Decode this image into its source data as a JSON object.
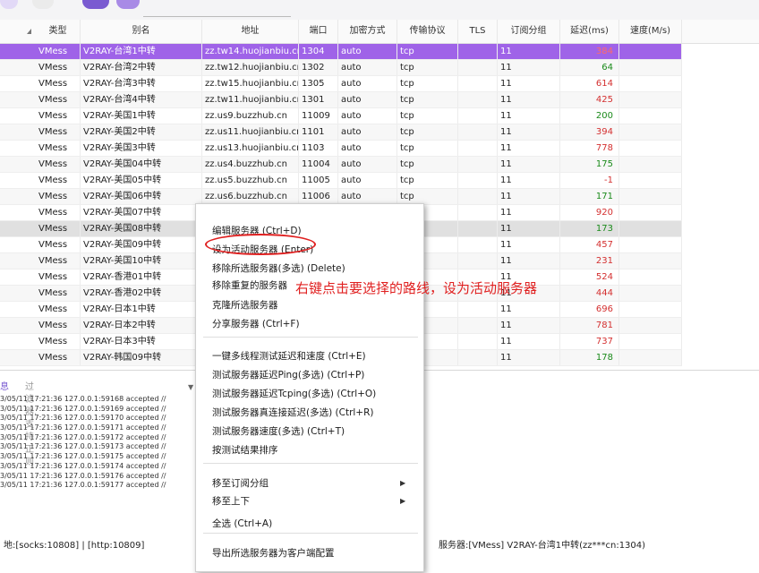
{
  "table": {
    "headers": [
      "类型",
      "别名",
      "地址",
      "端口",
      "加密方式",
      "传输协议",
      "TLS",
      "订阅分组",
      "延迟(ms)",
      "速度(M/s)"
    ],
    "rows": [
      {
        "type": "VMess",
        "alias": "V2RAY-台湾1中转",
        "addr": "zz.tw14.huojianbiu.cn",
        "port": "1304",
        "enc": "auto",
        "net": "tcp",
        "tls": "",
        "group": "11",
        "lat": "384",
        "speed": ""
      },
      {
        "type": "VMess",
        "alias": "V2RAY-台湾2中转",
        "addr": "zz.tw12.huojianbiu.cn",
        "port": "1302",
        "enc": "auto",
        "net": "tcp",
        "tls": "",
        "group": "11",
        "lat": "64",
        "speed": ""
      },
      {
        "type": "VMess",
        "alias": "V2RAY-台湾3中转",
        "addr": "zz.tw15.huojianbiu.cn",
        "port": "1305",
        "enc": "auto",
        "net": "tcp",
        "tls": "",
        "group": "11",
        "lat": "614",
        "speed": ""
      },
      {
        "type": "VMess",
        "alias": "V2RAY-台湾4中转",
        "addr": "zz.tw11.huojianbiu.cn",
        "port": "1301",
        "enc": "auto",
        "net": "tcp",
        "tls": "",
        "group": "11",
        "lat": "425",
        "speed": ""
      },
      {
        "type": "VMess",
        "alias": "V2RAY-美国1中转",
        "addr": "zz.us9.buzzhub.cn",
        "port": "11009",
        "enc": "auto",
        "net": "tcp",
        "tls": "",
        "group": "11",
        "lat": "200",
        "speed": ""
      },
      {
        "type": "VMess",
        "alias": "V2RAY-美国2中转",
        "addr": "zz.us11.huojianbiu.cn",
        "port": "1101",
        "enc": "auto",
        "net": "tcp",
        "tls": "",
        "group": "11",
        "lat": "394",
        "speed": ""
      },
      {
        "type": "VMess",
        "alias": "V2RAY-美国3中转",
        "addr": "zz.us13.huojianbiu.cn",
        "port": "1103",
        "enc": "auto",
        "net": "tcp",
        "tls": "",
        "group": "11",
        "lat": "778",
        "speed": ""
      },
      {
        "type": "VMess",
        "alias": "V2RAY-美国04中转",
        "addr": "zz.us4.buzzhub.cn",
        "port": "11004",
        "enc": "auto",
        "net": "tcp",
        "tls": "",
        "group": "11",
        "lat": "175",
        "speed": ""
      },
      {
        "type": "VMess",
        "alias": "V2RAY-美国05中转",
        "addr": "zz.us5.buzzhub.cn",
        "port": "11005",
        "enc": "auto",
        "net": "tcp",
        "tls": "",
        "group": "11",
        "lat": "-1",
        "speed": ""
      },
      {
        "type": "VMess",
        "alias": "V2RAY-美国06中转",
        "addr": "zz.us6.buzzhub.cn",
        "port": "11006",
        "enc": "auto",
        "net": "tcp",
        "tls": "",
        "group": "11",
        "lat": "171",
        "speed": ""
      },
      {
        "type": "VMess",
        "alias": "V2RAY-美国07中转",
        "addr": "",
        "port": "",
        "enc": "",
        "net": "",
        "tls": "",
        "group": "11",
        "lat": "920",
        "speed": ""
      },
      {
        "type": "VMess",
        "alias": "V2RAY-美国08中转",
        "addr": "",
        "port": "",
        "enc": "",
        "net": "",
        "tls": "",
        "group": "11",
        "lat": "173",
        "speed": ""
      },
      {
        "type": "VMess",
        "alias": "V2RAY-美国09中转",
        "addr": "",
        "port": "",
        "enc": "",
        "net": "",
        "tls": "",
        "group": "11",
        "lat": "457",
        "speed": ""
      },
      {
        "type": "VMess",
        "alias": "V2RAY-美国10中转",
        "addr": "",
        "port": "",
        "enc": "",
        "net": "",
        "tls": "",
        "group": "11",
        "lat": "231",
        "speed": ""
      },
      {
        "type": "VMess",
        "alias": "V2RAY-香港01中转",
        "addr": "",
        "port": "",
        "enc": "",
        "net": "",
        "tls": "",
        "group": "11",
        "lat": "524",
        "speed": ""
      },
      {
        "type": "VMess",
        "alias": "V2RAY-香港02中转",
        "addr": "",
        "port": "",
        "enc": "",
        "net": "",
        "tls": "",
        "group": "11",
        "lat": "444",
        "speed": ""
      },
      {
        "type": "VMess",
        "alias": "V2RAY-日本1中转",
        "addr": "",
        "port": "",
        "enc": "",
        "net": "",
        "tls": "",
        "group": "11",
        "lat": "696",
        "speed": ""
      },
      {
        "type": "VMess",
        "alias": "V2RAY-日本2中转",
        "addr": "",
        "port": "",
        "enc": "",
        "net": "",
        "tls": "",
        "group": "11",
        "lat": "781",
        "speed": ""
      },
      {
        "type": "VMess",
        "alias": "V2RAY-日本3中转",
        "addr": "",
        "port": "",
        "enc": "",
        "net": "",
        "tls": "",
        "group": "11",
        "lat": "737",
        "speed": ""
      },
      {
        "type": "VMess",
        "alias": "V2RAY-韩国09中转",
        "addr": "",
        "port": "",
        "enc": "",
        "net": "",
        "tls": "",
        "group": "11",
        "lat": "178",
        "speed": ""
      }
    ]
  },
  "log_panel": {
    "info_label": "息",
    "filter_placeholder": "过滤器, 支持正则",
    "lines": [
      "3/05/11 17:21:36 127.0.0.1:59168 accepted //",
      "3/05/11 17:21:36 127.0.0.1:59169 accepted //",
      "3/05/11 17:21:36 127.0.0.1:59170 accepted //",
      "3/05/11 17:21:36 127.0.0.1:59171 accepted //",
      "3/05/11 17:21:36 127.0.0.1:59172 accepted //",
      "3/05/11 17:21:36 127.0.0.1:59173 accepted //",
      "3/05/11 17:21:36 127.0.0.1:59175 accepted //",
      "3/05/11 17:21:36 127.0.0.1:59174 accepted //",
      "3/05/11 17:21:36 127.0.0.1:59176 accepted //",
      "3/05/11 17:21:36 127.0.0.1:59177 accepted //"
    ]
  },
  "status": {
    "left": "地:[socks:10808] | [http:10809]",
    "right": "服务器:[VMess] V2RAY-台湾1中转(zz***cn:1304)"
  },
  "context_menu": {
    "items": [
      {
        "label": "编辑服务器 (Ctrl+D)"
      },
      {
        "label": "设为活动服务器 (Enter)"
      },
      {
        "label": "移除所选服务器(多选) (Delete)"
      },
      {
        "label": "移除重复的服务器"
      },
      {
        "label": "克隆所选服务器"
      },
      {
        "label": "分享服务器 (Ctrl+F)"
      },
      {
        "label": "一键多线程测试延迟和速度 (Ctrl+E)"
      },
      {
        "label": "测试服务器延迟Ping(多选) (Ctrl+P)"
      },
      {
        "label": "测试服务器延迟Tcping(多选) (Ctrl+O)"
      },
      {
        "label": "测试服务器真连接延迟(多选) (Ctrl+R)"
      },
      {
        "label": "测试服务器速度(多选) (Ctrl+T)"
      },
      {
        "label": "按测试结果排序"
      },
      {
        "label": "移至订阅分组",
        "submenu_arrow": "▶"
      },
      {
        "label": "移至上下",
        "submenu_arrow": "▶"
      },
      {
        "label": "全选 (Ctrl+A)"
      },
      {
        "label": "导出所选服务器为客户端配置"
      }
    ]
  },
  "annotation": "右键点击要选择的路线，设为活动服务器",
  "colors": {
    "selected_row": "#9f63e8",
    "latency_ok": "#1a8a1a",
    "latency_bad": "#d43030",
    "annotation": "#e02020"
  }
}
